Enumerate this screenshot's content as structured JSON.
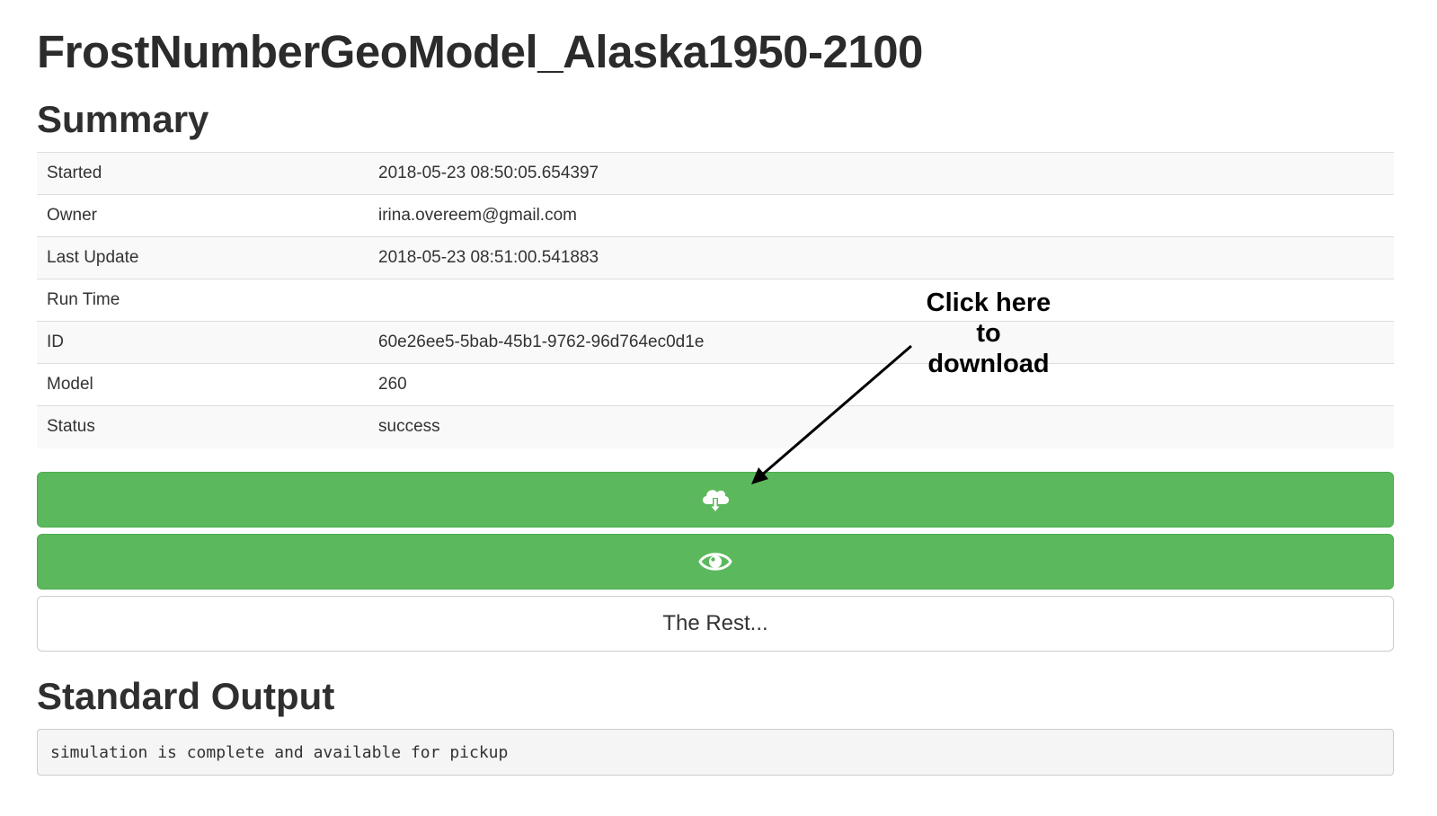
{
  "page": {
    "title": "FrostNumberGeoModel_Alaska1950-2100",
    "summary_heading": "Summary",
    "stdout_heading": "Standard Output"
  },
  "summary": {
    "rows": [
      {
        "label": "Started",
        "value": "2018-05-23 08:50:05.654397"
      },
      {
        "label": "Owner",
        "value": "irina.overeem@gmail.com"
      },
      {
        "label": "Last Update",
        "value": "2018-05-23 08:51:00.541883"
      },
      {
        "label": "Run Time",
        "value": ""
      },
      {
        "label": "ID",
        "value": "60e26ee5-5bab-45b1-9762-96d764ec0d1e"
      },
      {
        "label": "Model",
        "value": "260"
      },
      {
        "label": "Status",
        "value": "success"
      }
    ]
  },
  "buttons": {
    "download_icon": "cloud-download-icon",
    "view_icon": "eye-icon",
    "rest_label": "The Rest..."
  },
  "annotation": {
    "line1": "Click here",
    "line2": "to",
    "line3": "download"
  },
  "stdout": {
    "text": "simulation is complete and available for pickup"
  },
  "colors": {
    "button_green": "#5cb85c",
    "stripe": "#f9f9f9"
  }
}
